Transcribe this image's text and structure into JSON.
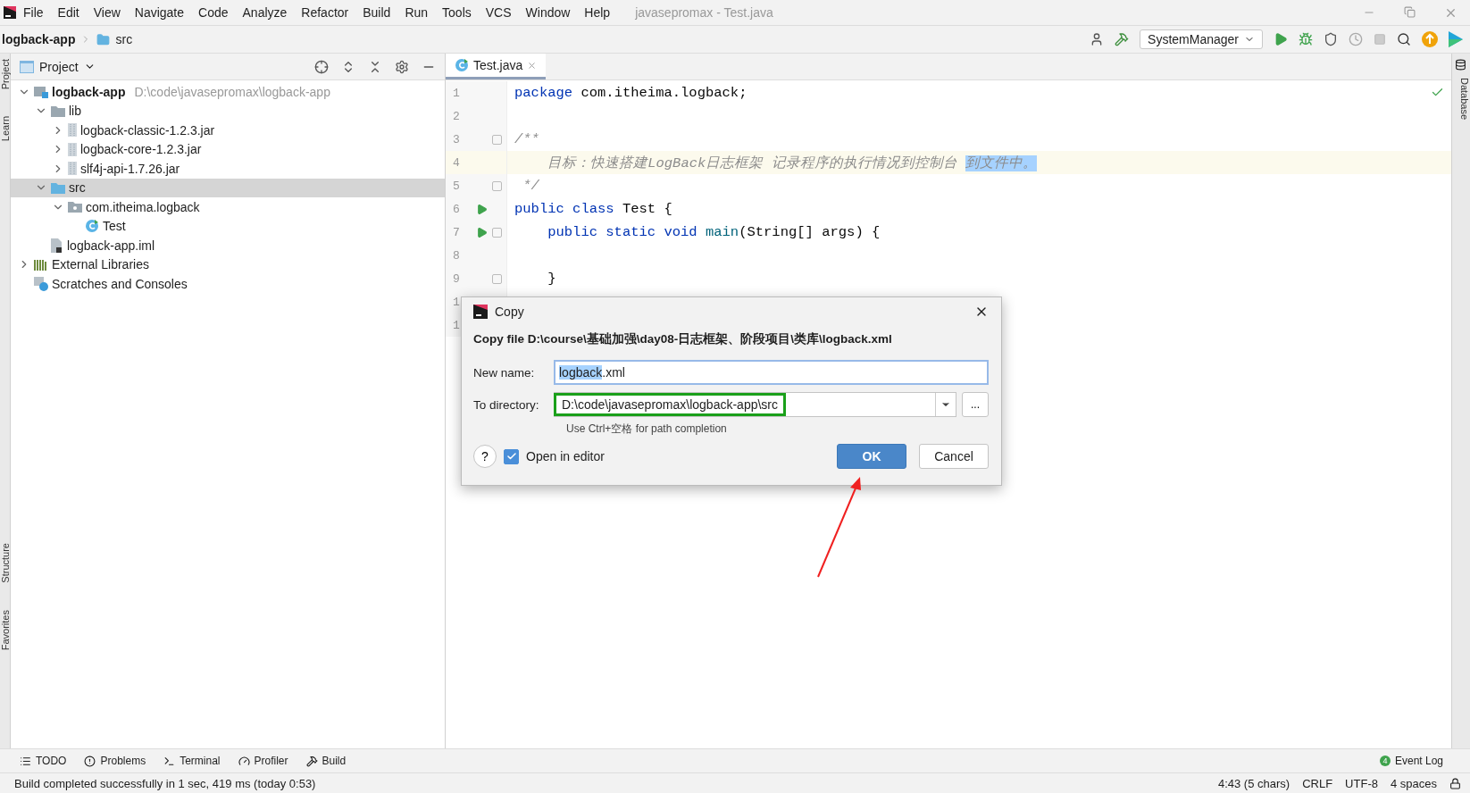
{
  "menu_bar": {
    "items": [
      "File",
      "Edit",
      "View",
      "Navigate",
      "Code",
      "Analyze",
      "Refactor",
      "Build",
      "Run",
      "Tools",
      "VCS",
      "Window",
      "Help"
    ],
    "title": "javasepromax - Test.java"
  },
  "navigation_bar": {
    "crumbs": [
      "logback-app",
      "src"
    ],
    "run_config": "SystemManager"
  },
  "project_panel": {
    "title": "Project",
    "tree": [
      {
        "label": "logback-app",
        "path": "D:\\code\\javasepromax\\logback-app",
        "kind": "module",
        "expanded": true,
        "selected": false,
        "children": [
          {
            "label": "lib",
            "kind": "folder",
            "expanded": true,
            "selected": false,
            "children": [
              {
                "label": "logback-classic-1.2.3.jar",
                "kind": "jar",
                "expanded": false,
                "selected": false
              },
              {
                "label": "logback-core-1.2.3.jar",
                "kind": "jar",
                "expanded": false,
                "selected": false
              },
              {
                "label": "slf4j-api-1.7.26.jar",
                "kind": "jar",
                "expanded": false,
                "selected": false
              }
            ]
          },
          {
            "label": "src",
            "kind": "source",
            "expanded": true,
            "selected": true,
            "children": [
              {
                "label": "com.itheima.logback",
                "kind": "package",
                "expanded": true,
                "selected": false,
                "children": [
                  {
                    "label": "Test",
                    "kind": "class",
                    "selected": false
                  }
                ]
              }
            ]
          },
          {
            "label": "logback-app.iml",
            "kind": "file",
            "selected": false
          }
        ]
      },
      {
        "label": "External Libraries",
        "kind": "libraries",
        "expanded": false,
        "selected": false
      },
      {
        "label": "Scratches and Consoles",
        "kind": "scratches",
        "selected": false
      }
    ]
  },
  "side_strips": {
    "left": [
      "Project",
      "Learn",
      "Structure",
      "Favorites"
    ],
    "right": [
      "Database"
    ]
  },
  "editor": {
    "tabs": [
      {
        "label": "Test.java",
        "selected": true
      }
    ],
    "lines": [
      {
        "number": "1",
        "tokens": [
          {
            "text": "package ",
            "kind": "kw"
          },
          {
            "text": "com.itheima.logback;",
            "kind": "plain"
          }
        ]
      },
      {
        "number": "2"
      },
      {
        "number": "3",
        "fold": true,
        "tokens": [
          {
            "text": "/**",
            "kind": "comment"
          }
        ]
      },
      {
        "number": "4",
        "current": true,
        "tokens": [
          {
            "text": "    目标：快速搭建LogBack日志框架 记录程序的执行情况到控制台 ",
            "kind": "doc"
          },
          {
            "text": "到文件中。",
            "kind": "doc",
            "selected": true
          }
        ]
      },
      {
        "number": "5",
        "fold": true,
        "tokens": [
          {
            "text": " */",
            "kind": "comment"
          }
        ]
      },
      {
        "number": "6",
        "run": true,
        "tokens": [
          {
            "text": "public class ",
            "kind": "kw"
          },
          {
            "text": "Test {",
            "kind": "plain"
          }
        ]
      },
      {
        "number": "7",
        "run": true,
        "fold": true,
        "tokens": [
          {
            "text": "    public static void ",
            "kind": "kw"
          },
          {
            "text": "main",
            "kind": "fn"
          },
          {
            "text": "(String[] args) {",
            "kind": "plain"
          }
        ]
      },
      {
        "number": "8"
      },
      {
        "number": "9",
        "fold": true,
        "tokens": [
          {
            "text": "    }",
            "kind": "plain"
          }
        ]
      },
      {
        "number": "1"
      },
      {
        "number": "1"
      }
    ]
  },
  "dialog": {
    "title": "Copy",
    "message": "Copy file D:\\course\\基础加强\\day08-日志框架、阶段项目\\类库\\logback.xml",
    "name_label": "New name:",
    "name_selected": "logback",
    "name_rest": ".xml",
    "dir_label": "To directory:",
    "dir_value": "D:\\code\\javasepromax\\logback-app\\src",
    "dir_highlighted": true,
    "hint": "Use Ctrl+空格 for path completion",
    "browse": "...",
    "help": "?",
    "open_in_editor": {
      "label": "Open in editor",
      "checked": true
    },
    "buttons": [
      {
        "label": "OK",
        "primary": true
      },
      {
        "label": "Cancel",
        "primary": false
      }
    ]
  },
  "tool_windows": {
    "items": [
      {
        "label": "TODO",
        "kind": "list"
      },
      {
        "label": "Problems",
        "kind": "alert"
      },
      {
        "label": "Terminal",
        "kind": "terminal"
      },
      {
        "label": "Profiler",
        "kind": "gauge"
      },
      {
        "label": "Build",
        "kind": "hammer"
      }
    ],
    "event_log": {
      "label": "Event Log",
      "count": "4"
    }
  },
  "status_bar": {
    "message": "Build completed successfully in 1 sec, 419 ms (today 0:53)",
    "fields": [
      "4:43 (5 chars)",
      "CRLF",
      "UTF-8",
      "4 spaces"
    ]
  }
}
